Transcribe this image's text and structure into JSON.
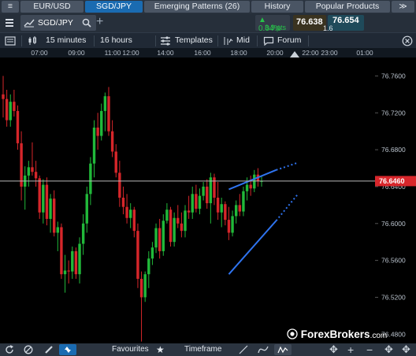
{
  "tabs": [
    {
      "label": "≡"
    },
    {
      "label": "EUR/USD"
    },
    {
      "label": "SGD/JPY"
    },
    {
      "label": "Emerging Patterns (26)"
    },
    {
      "label": "History"
    },
    {
      "label": "Popular Products"
    },
    {
      "label": "≫"
    }
  ],
  "instrument": {
    "symbol": "SGD/JPY",
    "change_pct": "0.04%",
    "change_pts": "3.3 pts",
    "sell": "76.638",
    "buy": "76.654",
    "spread": "1.6"
  },
  "toolbar": {
    "interval": "15 minutes",
    "range": "16 hours",
    "templates": "Templates",
    "price_type": "Mid",
    "forum": "Forum"
  },
  "time_axis": [
    "07:00",
    "09:00",
    "11:00",
    "12:00",
    "14:00",
    "16:00",
    "18:00",
    "20:00",
    "22:00",
    "23:00",
    "01:00"
  ],
  "price_axis": [
    "76.7600",
    "76.7200",
    "76.6800",
    "76.6400",
    "76.6000",
    "76.5600",
    "76.5200",
    "76.4800"
  ],
  "current_price": "76.6460",
  "bottom_bar": {
    "favourites": "Favourites",
    "timeframe": "Timeframe"
  },
  "watermark": {
    "brand": "ForexBrokers",
    "suffix": ".com"
  },
  "colors": {
    "up": "#21b93a",
    "down": "#d6262a",
    "trendline": "#2f74f0",
    "price_tag": "#d8262b"
  },
  "chart_data": {
    "type": "candlestick",
    "y_range": [
      76.47,
      76.78
    ],
    "candles": [
      {
        "o": 76.74,
        "h": 76.76,
        "l": 76.715,
        "c": 76.735
      },
      {
        "o": 76.735,
        "h": 76.745,
        "l": 76.705,
        "c": 76.712
      },
      {
        "o": 76.712,
        "h": 76.74,
        "l": 76.705,
        "c": 76.732
      },
      {
        "o": 76.732,
        "h": 76.745,
        "l": 76.716,
        "c": 76.722
      },
      {
        "o": 76.722,
        "h": 76.728,
        "l": 76.68,
        "c": 76.687
      },
      {
        "o": 76.687,
        "h": 76.7,
        "l": 76.625,
        "c": 76.64
      },
      {
        "o": 76.64,
        "h": 76.662,
        "l": 76.615,
        "c": 76.652
      },
      {
        "o": 76.652,
        "h": 76.668,
        "l": 76.64,
        "c": 76.661
      },
      {
        "o": 76.661,
        "h": 76.688,
        "l": 76.652,
        "c": 76.656
      },
      {
        "o": 76.656,
        "h": 76.668,
        "l": 76.64,
        "c": 76.649
      },
      {
        "o": 76.649,
        "h": 76.652,
        "l": 76.605,
        "c": 76.612
      },
      {
        "o": 76.612,
        "h": 76.648,
        "l": 76.6,
        "c": 76.642
      },
      {
        "o": 76.642,
        "h": 76.65,
        "l": 76.598,
        "c": 76.605
      },
      {
        "o": 76.605,
        "h": 76.632,
        "l": 76.59,
        "c": 76.627
      },
      {
        "o": 76.627,
        "h": 76.636,
        "l": 76.586,
        "c": 76.59
      },
      {
        "o": 76.59,
        "h": 76.602,
        "l": 76.57,
        "c": 76.596
      },
      {
        "o": 76.596,
        "h": 76.6,
        "l": 76.54,
        "c": 76.545
      },
      {
        "o": 76.545,
        "h": 76.566,
        "l": 76.525,
        "c": 76.549
      },
      {
        "o": 76.549,
        "h": 76.56,
        "l": 76.535,
        "c": 76.548
      },
      {
        "o": 76.548,
        "h": 76.575,
        "l": 76.54,
        "c": 76.57
      },
      {
        "o": 76.57,
        "h": 76.574,
        "l": 76.54,
        "c": 76.545
      },
      {
        "o": 76.545,
        "h": 76.585,
        "l": 76.535,
        "c": 76.578
      },
      {
        "o": 76.578,
        "h": 76.61,
        "l": 76.566,
        "c": 76.6
      },
      {
        "o": 76.6,
        "h": 76.64,
        "l": 76.59,
        "c": 76.632
      },
      {
        "o": 76.632,
        "h": 76.672,
        "l": 76.62,
        "c": 76.665
      },
      {
        "o": 76.665,
        "h": 76.712,
        "l": 76.65,
        "c": 76.704
      },
      {
        "o": 76.704,
        "h": 76.72,
        "l": 76.68,
        "c": 76.695
      },
      {
        "o": 76.695,
        "h": 76.73,
        "l": 76.69,
        "c": 76.722
      },
      {
        "o": 76.722,
        "h": 76.742,
        "l": 76.7,
        "c": 76.738
      },
      {
        "o": 76.738,
        "h": 76.748,
        "l": 76.695,
        "c": 76.7
      },
      {
        "o": 76.7,
        "h": 76.712,
        "l": 76.672,
        "c": 76.678
      },
      {
        "o": 76.678,
        "h": 76.686,
        "l": 76.65,
        "c": 76.655
      },
      {
        "o": 76.655,
        "h": 76.668,
        "l": 76.618,
        "c": 76.628
      },
      {
        "o": 76.628,
        "h": 76.64,
        "l": 76.61,
        "c": 76.618
      },
      {
        "o": 76.618,
        "h": 76.632,
        "l": 76.6,
        "c": 76.606
      },
      {
        "o": 76.606,
        "h": 76.622,
        "l": 76.595,
        "c": 76.615
      },
      {
        "o": 76.615,
        "h": 76.618,
        "l": 76.585,
        "c": 76.592
      },
      {
        "o": 76.592,
        "h": 76.6,
        "l": 76.53,
        "c": 76.54
      },
      {
        "o": 76.54,
        "h": 76.548,
        "l": 76.472,
        "c": 76.52
      },
      {
        "o": 76.52,
        "h": 76.548,
        "l": 76.515,
        "c": 76.545
      },
      {
        "o": 76.545,
        "h": 76.57,
        "l": 76.53,
        "c": 76.562
      },
      {
        "o": 76.562,
        "h": 76.58,
        "l": 76.555,
        "c": 76.574
      },
      {
        "o": 76.574,
        "h": 76.6,
        "l": 76.568,
        "c": 76.595
      },
      {
        "o": 76.595,
        "h": 76.605,
        "l": 76.562,
        "c": 76.57
      },
      {
        "o": 76.57,
        "h": 76.61,
        "l": 76.565,
        "c": 76.603
      },
      {
        "o": 76.603,
        "h": 76.622,
        "l": 76.6,
        "c": 76.615
      },
      {
        "o": 76.615,
        "h": 76.618,
        "l": 76.575,
        "c": 76.58
      },
      {
        "o": 76.58,
        "h": 76.612,
        "l": 76.575,
        "c": 76.606
      },
      {
        "o": 76.606,
        "h": 76.62,
        "l": 76.595,
        "c": 76.6
      },
      {
        "o": 76.6,
        "h": 76.612,
        "l": 76.585,
        "c": 76.592
      },
      {
        "o": 76.592,
        "h": 76.62,
        "l": 76.585,
        "c": 76.614
      },
      {
        "o": 76.614,
        "h": 76.63,
        "l": 76.605,
        "c": 76.612
      },
      {
        "o": 76.612,
        "h": 76.64,
        "l": 76.605,
        "c": 76.632
      },
      {
        "o": 76.632,
        "h": 76.642,
        "l": 76.612,
        "c": 76.616
      },
      {
        "o": 76.616,
        "h": 76.638,
        "l": 76.61,
        "c": 76.63
      },
      {
        "o": 76.63,
        "h": 76.645,
        "l": 76.625,
        "c": 76.64
      },
      {
        "o": 76.64,
        "h": 76.648,
        "l": 76.616,
        "c": 76.622
      },
      {
        "o": 76.622,
        "h": 76.655,
        "l": 76.6,
        "c": 76.65
      },
      {
        "o": 76.65,
        "h": 76.654,
        "l": 76.62,
        "c": 76.628
      },
      {
        "o": 76.628,
        "h": 76.645,
        "l": 76.604,
        "c": 76.612
      },
      {
        "o": 76.612,
        "h": 76.628,
        "l": 76.596,
        "c": 76.621
      },
      {
        "o": 76.621,
        "h": 76.624,
        "l": 76.598,
        "c": 76.604
      },
      {
        "o": 76.604,
        "h": 76.618,
        "l": 76.582,
        "c": 76.59
      },
      {
        "o": 76.59,
        "h": 76.614,
        "l": 76.586,
        "c": 76.608
      },
      {
        "o": 76.608,
        "h": 76.625,
        "l": 76.6,
        "c": 76.62
      },
      {
        "o": 76.62,
        "h": 76.632,
        "l": 76.608,
        "c": 76.613
      },
      {
        "o": 76.613,
        "h": 76.64,
        "l": 76.608,
        "c": 76.635
      },
      {
        "o": 76.635,
        "h": 76.65,
        "l": 76.625,
        "c": 76.642
      },
      {
        "o": 76.642,
        "h": 76.652,
        "l": 76.63,
        "c": 76.638
      },
      {
        "o": 76.638,
        "h": 76.658,
        "l": 76.634,
        "c": 76.653
      },
      {
        "o": 76.653,
        "h": 76.66,
        "l": 76.64,
        "c": 76.646
      },
      {
        "o": 76.646,
        "h": 76.652,
        "l": 76.64,
        "c": 76.646
      }
    ],
    "trendlines": [
      {
        "from": {
          "i": 62,
          "p": 76.637
        },
        "to": {
          "i": 75,
          "p": 76.658
        },
        "ext": {
          "i": 81,
          "p": 76.666
        }
      },
      {
        "from": {
          "i": 62,
          "p": 76.545
        },
        "to": {
          "i": 75,
          "p": 76.603
        },
        "ext": {
          "i": 81,
          "p": 76.632
        }
      }
    ]
  }
}
